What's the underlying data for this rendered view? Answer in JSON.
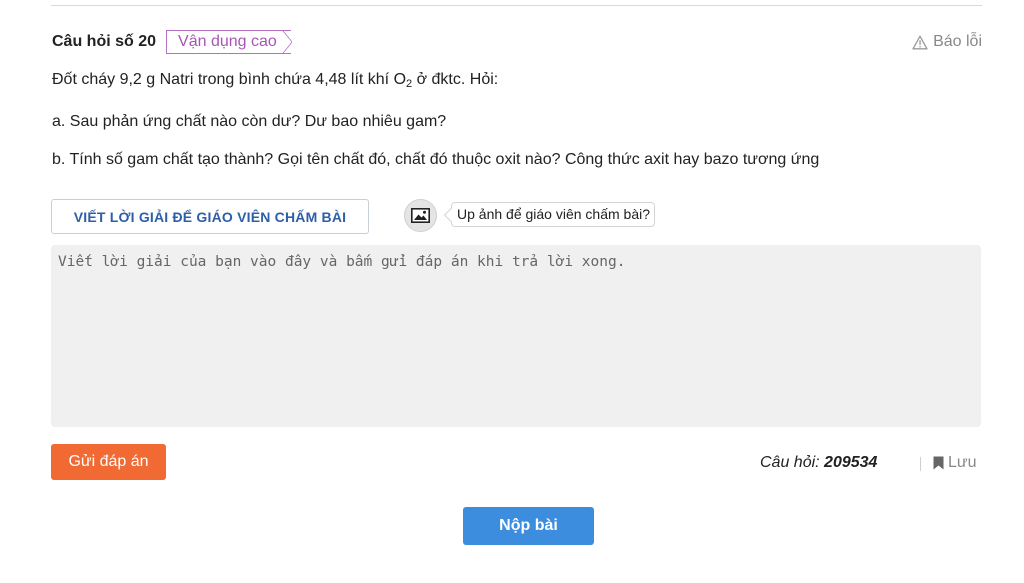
{
  "question": {
    "number_label": "Câu hỏi số 20",
    "level": "Vận dụng cao",
    "report_label": "Báo lỗi",
    "line1_before": "Đốt cháy 9,2 g Natri trong bình chứa 4,48 lít khí O",
    "line1_sub": "2",
    "line1_after": " ở đktc. Hỏi:",
    "line2": "a. Sau phản ứng chất nào còn dư? Dư bao nhiêu gam?",
    "line3": "b. Tính số gam chất tạo thành? Gọi tên chất đó, chất đó thuộc oxit nào? Công thức axit hay bazo tương ứng"
  },
  "answer": {
    "write_button": "VIẾT LỜI GIẢI ĐỂ GIÁO VIÊN CHẤM BÀI",
    "photo_icon": "image-icon",
    "photo_tip": "Up ảnh để giáo viên chấm bài?",
    "placeholder": "Viết lời giải của bạn vào đây và bấm gửi đáp án khi trả lời xong.",
    "value": ""
  },
  "footer": {
    "submit_answer": "Gửi đáp án",
    "qid_label": "Câu hỏi: ",
    "qid_value": "209534",
    "save_label": "Lưu",
    "save_icon": "bookmark-icon",
    "submit_all": "Nộp bài"
  },
  "colors": {
    "level_tag": "#a855b6",
    "write_button_text": "#2d5fa8",
    "submit_answer_bg": "#f26a33",
    "submit_all_bg": "#3d8ddf"
  }
}
